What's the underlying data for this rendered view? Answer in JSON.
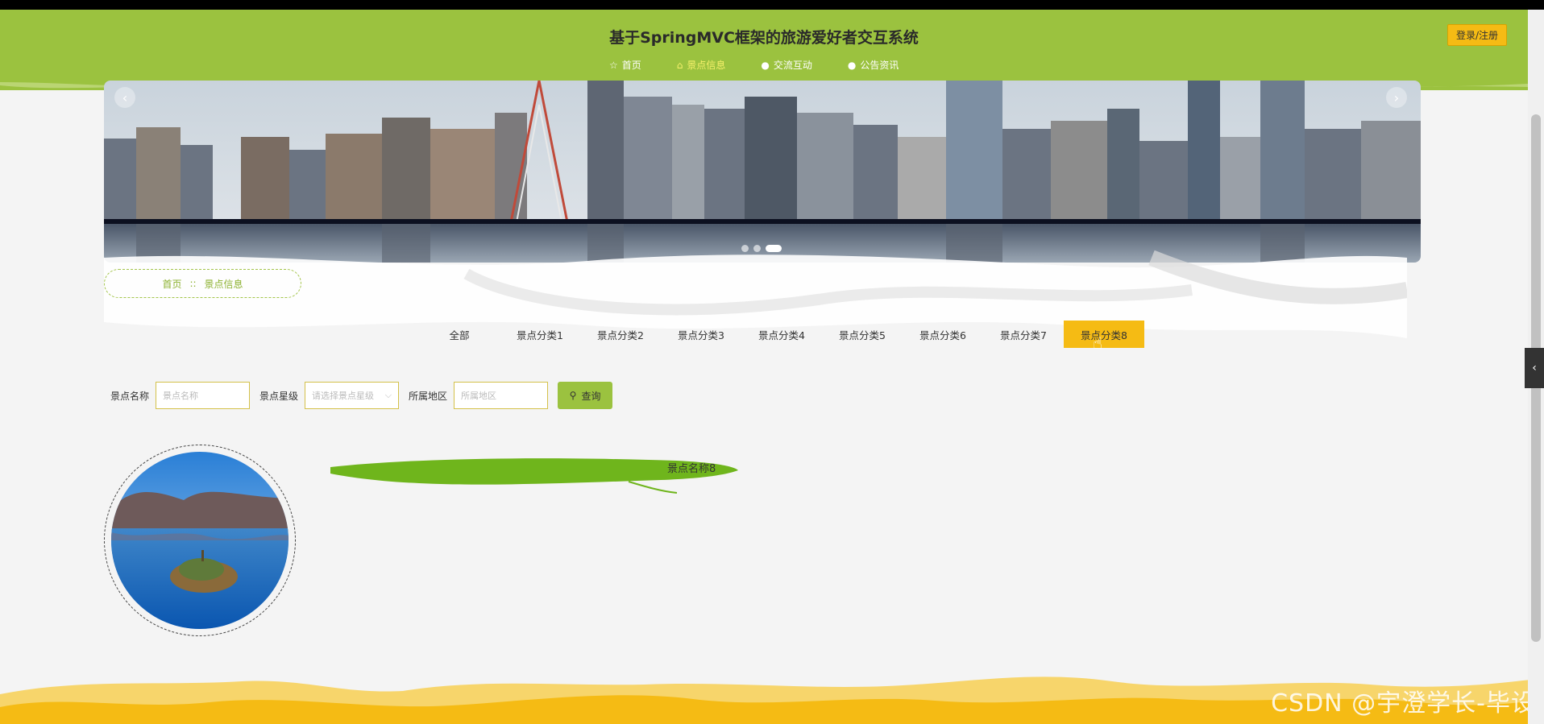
{
  "header": {
    "title": "基于SpringMVC框架的旅游爱好者交互系统",
    "login_label": "登录/注册",
    "nav": [
      {
        "label": "首页",
        "icon": "star-icon"
      },
      {
        "label": "景点信息",
        "icon": "home-icon",
        "active": true
      },
      {
        "label": "交流互动",
        "icon": "circle-icon"
      },
      {
        "label": "公告资讯",
        "icon": "circle-icon"
      }
    ]
  },
  "breadcrumb": {
    "home": "首页",
    "separator": "::",
    "current": "景点信息"
  },
  "categories": [
    "全部",
    "景点分类1",
    "景点分类2",
    "景点分类3",
    "景点分类4",
    "景点分类5",
    "景点分类6",
    "景点分类7",
    "景点分类8"
  ],
  "active_category": "景点分类8",
  "search": {
    "name_label": "景点名称",
    "name_placeholder": "景点名称",
    "star_label": "景点星级",
    "star_placeholder": "请选择景点星级",
    "area_label": "所属地区",
    "area_placeholder": "所属地区",
    "query_label": "查询"
  },
  "results": [
    {
      "name": "景点名称8"
    }
  ],
  "watermark": "CSDN @宇澄学长-毕设",
  "colors": {
    "primary": "#9bc23f",
    "accent": "#f5bb14"
  }
}
